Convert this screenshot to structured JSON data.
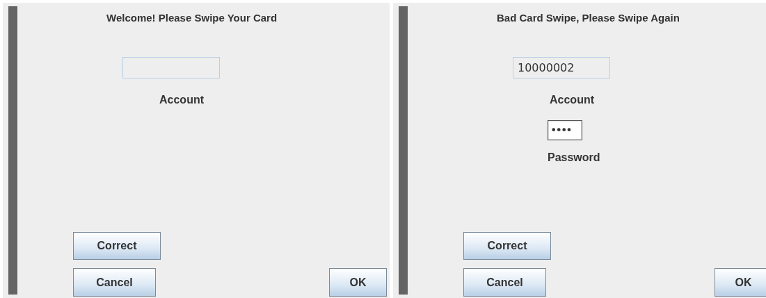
{
  "panels": [
    {
      "title": "Welcome! Please Swipe Your Card",
      "fields": [
        {
          "kind": "text",
          "label": "Account",
          "focused": false
        }
      ],
      "buttons": [
        {
          "label": "Correct"
        },
        {
          "label": "Cancel"
        },
        {
          "label": "OK"
        }
      ]
    },
    {
      "title": "Bad Card Swipe, Please Swipe Again",
      "fields": [
        {
          "kind": "text",
          "value": "10000002",
          "label": "Account",
          "focused": false
        },
        {
          "kind": "password",
          "value": "••••",
          "label": "Password",
          "focused": true
        }
      ],
      "buttons": [
        {
          "label": "Correct"
        },
        {
          "label": "Cancel"
        },
        {
          "label": "OK"
        }
      ]
    }
  ]
}
